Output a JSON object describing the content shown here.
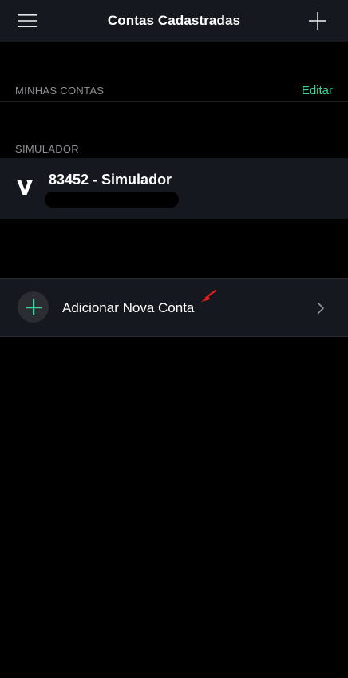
{
  "navbar": {
    "title": "Contas Cadastradas",
    "menu_icon": "hamburger-menu-icon",
    "add_icon": "plus-icon"
  },
  "my_accounts": {
    "label": "MINHAS CONTAS",
    "edit_label": "Editar"
  },
  "simulator": {
    "label": "SIMULADOR",
    "account": {
      "name": "83452 - Simulador",
      "logo_icon": "v-logo-icon"
    }
  },
  "add_account": {
    "label": "Adicionar Nova Conta",
    "icon": "plus-circle-icon",
    "chevron_icon": "chevron-right-icon"
  },
  "colors": {
    "background": "#000000",
    "surface": "#16181f",
    "accent": "#3ad39a",
    "muted_text": "#8e8e93"
  }
}
